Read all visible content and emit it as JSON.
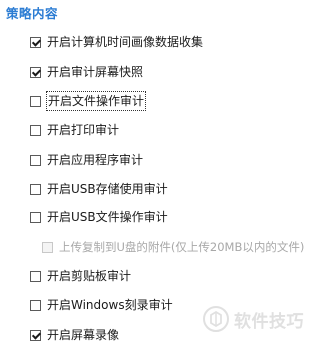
{
  "section": {
    "title": "策略内容"
  },
  "options": [
    {
      "label": "开启计算机时间画像数据收集",
      "checked": true,
      "disabled": false
    },
    {
      "label": "开启审计屏幕快照",
      "checked": true,
      "disabled": false
    },
    {
      "label": "开启文件操作审计",
      "checked": false,
      "disabled": false,
      "focused": true
    },
    {
      "label": "开启打印审计",
      "checked": false,
      "disabled": false
    },
    {
      "label": "开启应用程序审计",
      "checked": false,
      "disabled": false
    },
    {
      "label": "开启USB存储使用审计",
      "checked": false,
      "disabled": false
    },
    {
      "label": "开启USB文件操作审计",
      "checked": false,
      "disabled": false
    },
    {
      "label": "上传复制到U盘的附件(仅上传20MB以内的文件)",
      "checked": false,
      "disabled": true
    },
    {
      "label": "开启剪贴板审计",
      "checked": false,
      "disabled": false
    },
    {
      "label": "开启Windows刻录审计",
      "checked": false,
      "disabled": false
    },
    {
      "label": "开启屏幕录像",
      "checked": true,
      "disabled": false
    }
  ],
  "watermark": {
    "text": "软件技巧",
    "icon": "watermark-logo-icon"
  }
}
